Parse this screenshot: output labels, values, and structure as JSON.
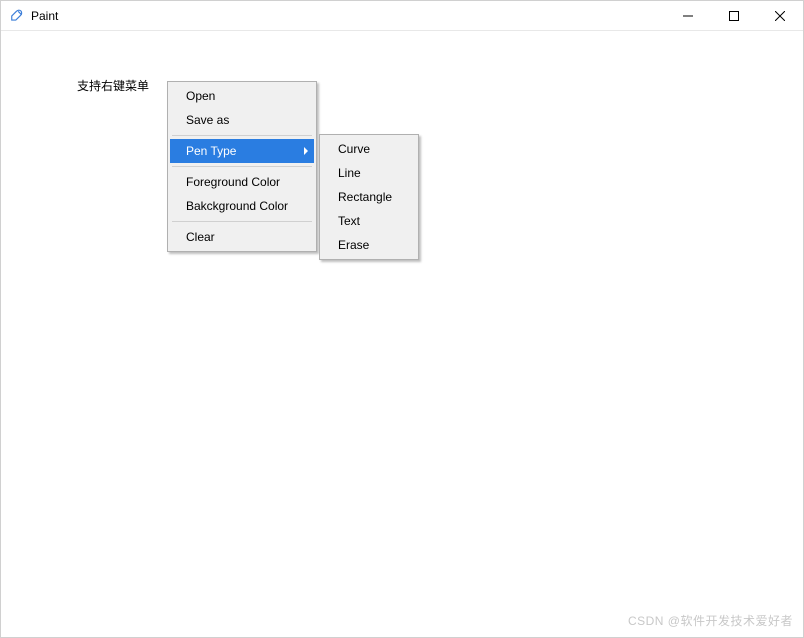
{
  "window": {
    "title": "Paint"
  },
  "canvas": {
    "text": "支持右键菜单"
  },
  "contextMenu": {
    "open": "Open",
    "saveAs": "Save as",
    "penType": "Pen Type",
    "fgColor": "Foreground Color",
    "bgColor": "Bakckground Color",
    "clear": "Clear"
  },
  "submenu": {
    "curve": "Curve",
    "line": "Line",
    "rectangle": "Rectangle",
    "text": "Text",
    "erase": "Erase"
  },
  "watermark": "CSDN @软件开发技术爱好者"
}
